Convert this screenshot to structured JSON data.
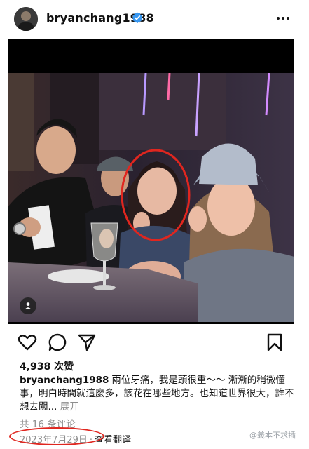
{
  "header": {
    "username": "bryanchang1988",
    "more_label": "⋮"
  },
  "post": {
    "likes": "4,938 次赞",
    "caption_username": "bryanchang1988",
    "caption_text": "兩位牙痛，我是頭很重～～ 漸漸的稍微懂事，明白時間就這麼多，該花在哪些地方。也知道世界很大，誰不想去闖...",
    "caption_more": "展开",
    "comments_label": "共 16 条评论",
    "date": "2023年7月29日",
    "separator": "·",
    "translate_label": "查看翻译"
  },
  "watermark": "@義本不求插",
  "colors": {
    "verified": "#3897f0",
    "annotation_circle": "#e0261f",
    "muted_text": "#8e8e8e"
  },
  "icons": [
    "more-icon",
    "verified-badge-icon",
    "user-tag-icon",
    "heart-icon",
    "comment-icon",
    "share-icon",
    "bookmark-icon"
  ]
}
